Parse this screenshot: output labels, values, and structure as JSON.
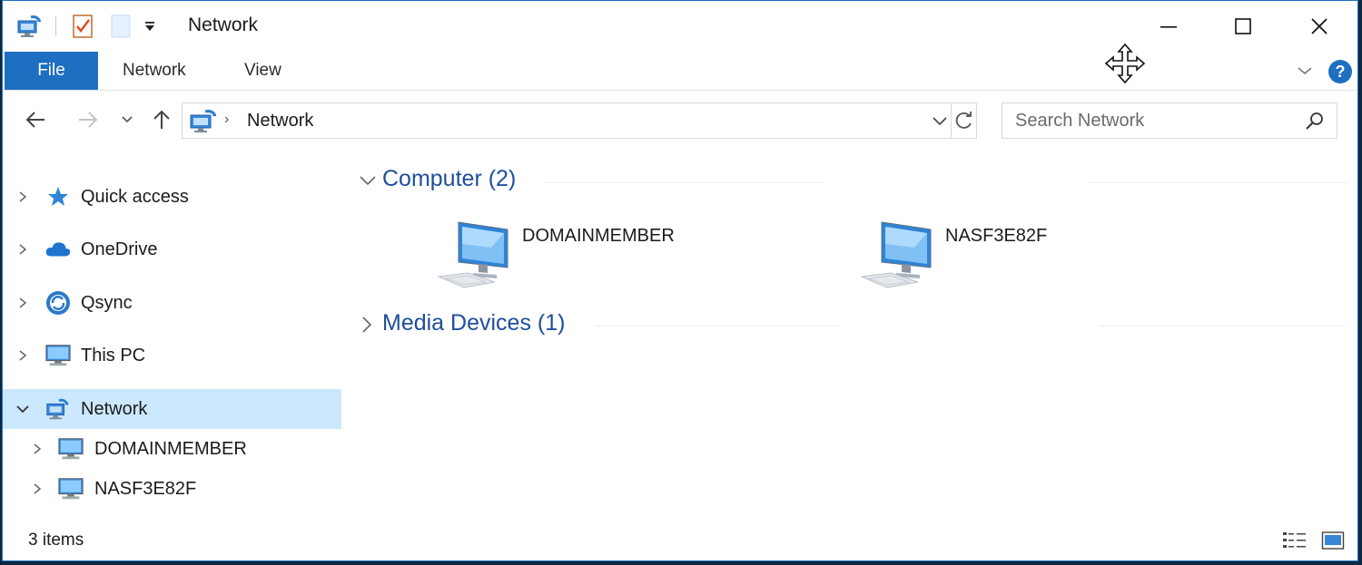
{
  "window": {
    "title": "Network"
  },
  "ribbon": {
    "tabs": [
      {
        "label": "File",
        "active": true
      },
      {
        "label": "Network",
        "active": false
      },
      {
        "label": "View",
        "active": false
      }
    ],
    "help_label": "?"
  },
  "navigation": {
    "address_segments": [
      "Network"
    ],
    "search_placeholder": "Search Network"
  },
  "sidebar": {
    "items": [
      {
        "label": "Quick access",
        "icon": "star-icon",
        "expanded": false
      },
      {
        "label": "OneDrive",
        "icon": "cloud-icon",
        "expanded": false
      },
      {
        "label": "Qsync",
        "icon": "sync-icon",
        "expanded": false
      },
      {
        "label": "This PC",
        "icon": "monitor-icon",
        "expanded": false
      },
      {
        "label": "Network",
        "icon": "network-icon",
        "expanded": true,
        "selected": true
      },
      {
        "label": "DOMAINMEMBER",
        "icon": "monitor-icon",
        "expanded": false
      },
      {
        "label": "NASF3E82F",
        "icon": "monitor-icon",
        "expanded": false
      }
    ]
  },
  "content": {
    "groups": [
      {
        "label": "Computer (2)",
        "expanded": true,
        "items": [
          "DOMAINMEMBER",
          "NASF3E82F"
        ]
      },
      {
        "label": "Media Devices (1)",
        "expanded": false,
        "items": []
      }
    ]
  },
  "status": {
    "item_count": "3 items"
  },
  "colors": {
    "accent": "#1e6fc2",
    "selection": "#cce8ff",
    "group_header": "#1e4e9c"
  }
}
